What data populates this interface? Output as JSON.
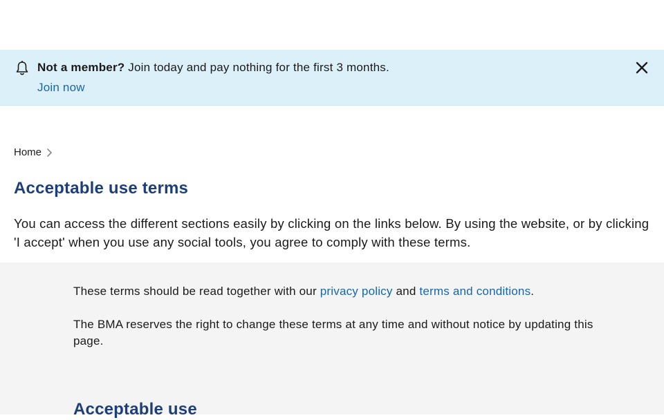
{
  "banner": {
    "bold_text": "Not a member?",
    "text": " Join today and pay nothing for the first 3 months.",
    "link": "Join now",
    "bell_icon": "bell-icon",
    "close_icon": "close-icon"
  },
  "breadcrumb": {
    "home": "Home",
    "chevron_icon": "chevron-right-icon"
  },
  "page": {
    "title": "Acceptable use terms",
    "intro": "You can access the different sections easily by clicking on the links below. By using the website, or by clicking 'I accept' when you use any social tools, you agree to comply with these terms."
  },
  "content": {
    "p1_prefix": "These terms should be read together with our ",
    "privacy_link": "privacy policy",
    "p1_mid": " and ",
    "terms_link": "terms and conditions",
    "p1_suffix": ".",
    "p2": "The BMA reserves the right to change these terms at any time and without notice by updating this page.",
    "section_title": "Acceptable use"
  },
  "colors": {
    "banner_bg": "#dcf0fa",
    "link": "#1b66a6",
    "heading": "#1c3f7a",
    "content_bg": "#f4f4f4"
  }
}
